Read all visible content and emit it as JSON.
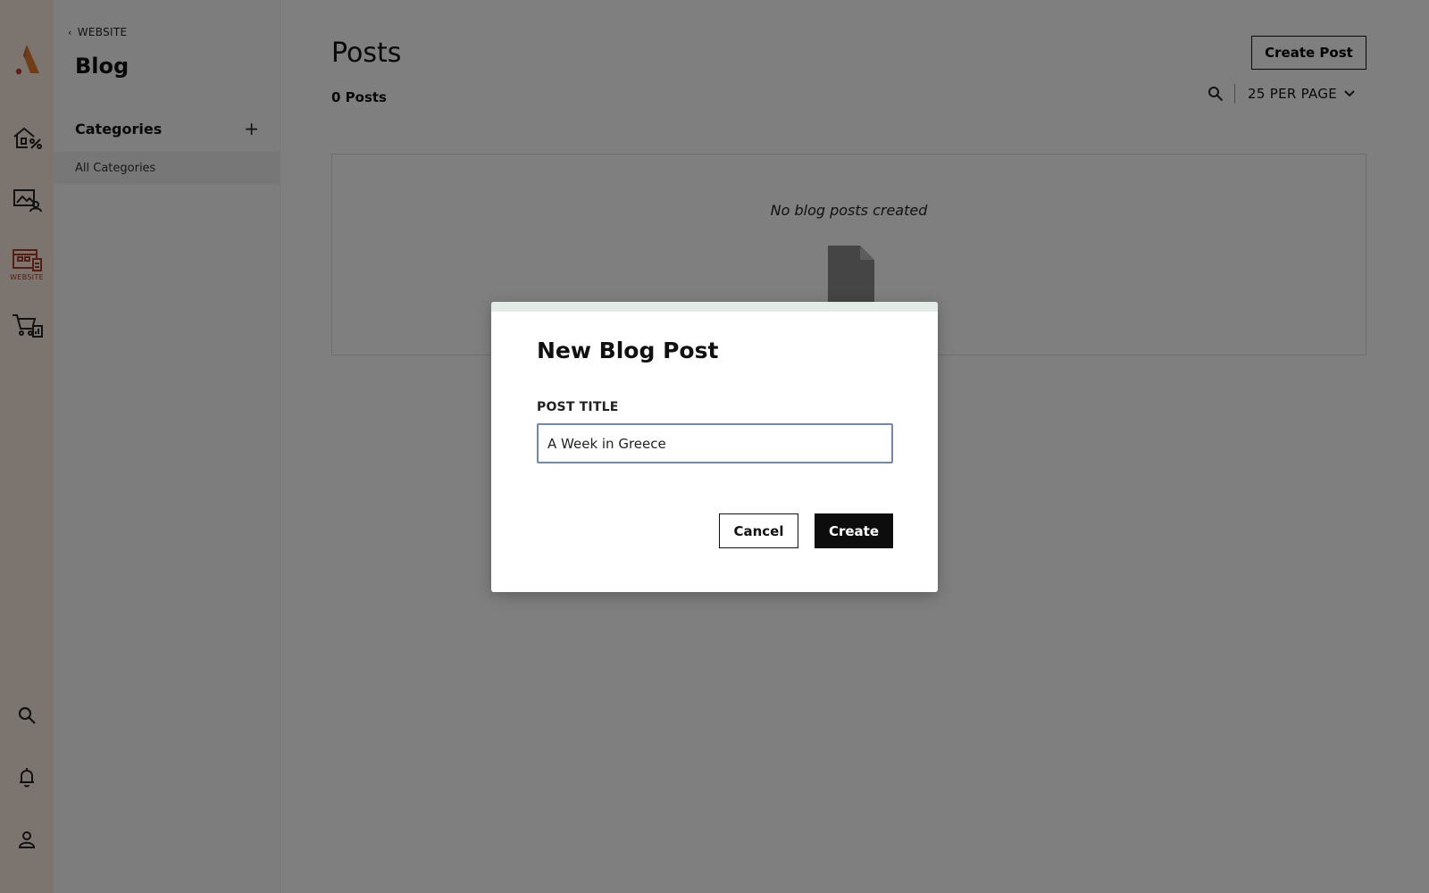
{
  "rail": {
    "website_caption": "WEBSITE",
    "accent_color": "#b03a22",
    "items": [
      {
        "icon": "home-percent-icon"
      },
      {
        "icon": "gallery-user-icon"
      },
      {
        "icon": "website-icon"
      },
      {
        "icon": "cart-analytics-icon"
      },
      {
        "icon": "search-icon"
      },
      {
        "icon": "bell-icon"
      },
      {
        "icon": "user-icon"
      }
    ]
  },
  "sidebar": {
    "back_label": "WEBSITE",
    "title": "Blog",
    "categories_label": "Categories",
    "add_icon": "plus-icon",
    "items": [
      {
        "label": "All Categories"
      }
    ]
  },
  "main": {
    "title": "Posts",
    "count": "0 Posts",
    "create_button": "Create Post",
    "per_page": "25 PER PAGE",
    "empty_message": "No blog posts created"
  },
  "modal": {
    "title": "New Blog Post",
    "field_label": "POST TITLE",
    "field_value": "A Week in Greece",
    "cancel_label": "Cancel",
    "create_label": "Create"
  }
}
